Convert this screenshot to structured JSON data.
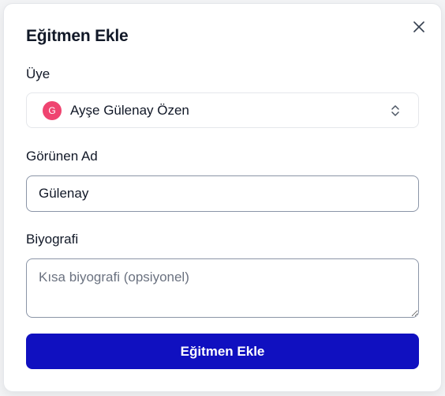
{
  "dialog": {
    "title": "Eğitmen Ekle",
    "close_icon": "close-icon"
  },
  "member": {
    "label": "Üye",
    "avatar_initial": "G",
    "selected_value": "Ayşe Gülenay Özen",
    "avatar_color": "#ef4470"
  },
  "display_name": {
    "label": "Görünen Ad",
    "value": "Gülenay"
  },
  "biography": {
    "label": "Biyografi",
    "placeholder": "Kısa biyografi (opsiyonel)",
    "value": ""
  },
  "submit": {
    "label": "Eğitmen Ekle",
    "color": "#1010c0"
  }
}
